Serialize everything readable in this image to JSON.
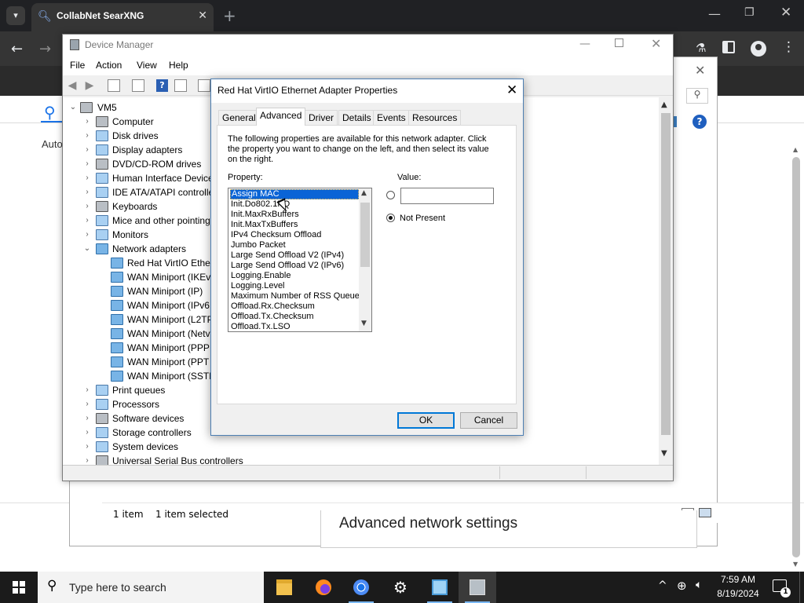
{
  "browser": {
    "tab_title": "CollabNet SearXNG",
    "tab_close": "✕",
    "new_tab": "+",
    "page_auto_text": "Auto"
  },
  "netconn": {
    "status_count": "1 item",
    "status_selected": "1 item selected",
    "advanced_network_settings": "Advanced network settings"
  },
  "device_manager": {
    "title": "Device Manager",
    "menu": [
      "File",
      "Action",
      "View",
      "Help"
    ],
    "tree": {
      "root": "VM5",
      "categories": [
        {
          "label": "Computer"
        },
        {
          "label": "Disk drives"
        },
        {
          "label": "Display adapters"
        },
        {
          "label": "DVD/CD-ROM drives"
        },
        {
          "label": "Human Interface Device"
        },
        {
          "label": "IDE ATA/ATAPI controlle"
        },
        {
          "label": "Keyboards"
        },
        {
          "label": "Mice and other pointing"
        },
        {
          "label": "Monitors"
        },
        {
          "label": "Network adapters"
        },
        {
          "label": "Print queues"
        },
        {
          "label": "Processors"
        },
        {
          "label": "Software devices"
        },
        {
          "label": "Storage controllers"
        },
        {
          "label": "System devices"
        },
        {
          "label": "Universal Serial Bus controllers"
        }
      ],
      "network_adapters": [
        "Red Hat VirtIO Etherı",
        "WAN Miniport (IKEv",
        "WAN Miniport (IP)",
        "WAN Miniport (IPv6",
        "WAN Miniport (L2TP",
        "WAN Miniport (Netv",
        "WAN Miniport (PPP",
        "WAN Miniport (PPT",
        "WAN Miniport (SSTF"
      ]
    }
  },
  "properties_dialog": {
    "title": "Red Hat VirtIO Ethernet Adapter Properties",
    "tabs": [
      "General",
      "Advanced",
      "Driver",
      "Details",
      "Events",
      "Resources"
    ],
    "active_tab": "Advanced",
    "description": "The following properties are available for this network adapter. Click the property you want to change on the left, and then select its value on the right.",
    "property_label": "Property:",
    "value_label": "Value:",
    "properties": [
      "Assign MAC",
      "Init.Do802.1PQ",
      "Init.MaxRxBuffers",
      "Init.MaxTxBuffers",
      "IPv4 Checksum Offload",
      "Jumbo Packet",
      "Large Send Offload V2 (IPv4)",
      "Large Send Offload V2 (IPv6)",
      "Logging.Enable",
      "Logging.Level",
      "Maximum Number of RSS Queues",
      "Offload.Rx.Checksum",
      "Offload.Tx.Checksum",
      "Offload.Tx.LSO"
    ],
    "selected_property": "Assign MAC",
    "value_input": "",
    "not_present_label": "Not Present",
    "ok_label": "OK",
    "cancel_label": "Cancel"
  },
  "taskbar": {
    "search_placeholder": "Type here to search",
    "time": "7:59 AM",
    "date": "8/19/2024",
    "notification_count": "1"
  }
}
